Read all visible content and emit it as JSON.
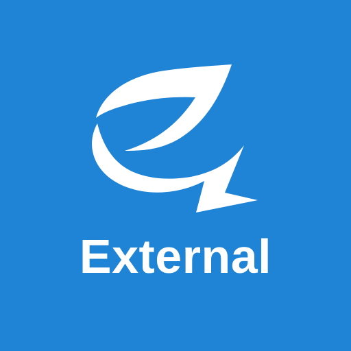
{
  "icon": {
    "name": "leaf-z-logo-icon",
    "label": "External",
    "background_color": "#1f83d6",
    "foreground_color": "#ffffff"
  }
}
